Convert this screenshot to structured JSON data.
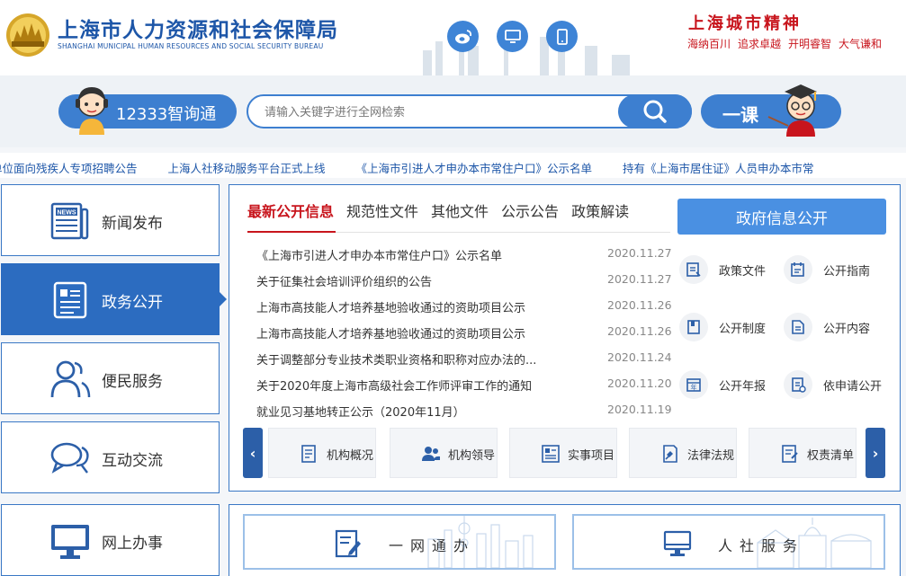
{
  "header": {
    "title_cn": "上海市人力资源和社会保障局",
    "title_en": "SHANGHAI MUNICIPAL HUMAN RESOURCES AND SOCIAL SECURITY BUREAU",
    "social_icons": [
      "weibo-icon",
      "desktop-icon",
      "mobile-icon"
    ],
    "spirit_title": "上海城市精神",
    "spirit_words": [
      "海纳百川",
      "追求卓越",
      "开明睿智",
      "大气谦和"
    ]
  },
  "search": {
    "hotline_label": "12333智询通",
    "placeholder": "请输入关键字进行全网检索",
    "course_label": "一课"
  },
  "ticker": {
    "items": [
      "单位面向残疾人专项招聘公告",
      "上海人社移动服务平台正式上线",
      "《上海市引进人才申办本市常住户口》公示名单",
      "持有《上海市居住证》人员申办本市常"
    ]
  },
  "nav": {
    "items": [
      {
        "label": "新闻发布",
        "icon": "newspaper-icon"
      },
      {
        "label": "政务公开",
        "icon": "document-icon",
        "active": true
      },
      {
        "label": "便民服务",
        "icon": "people-icon"
      },
      {
        "label": "互动交流",
        "icon": "chat-icon"
      },
      {
        "label": "网上办事",
        "icon": "monitor-icon"
      }
    ]
  },
  "main": {
    "tabs": [
      "最新公开信息",
      "规范性文件",
      "其他文件",
      "公示公告",
      "政策解读"
    ],
    "news": [
      {
        "title": "《上海市引进人才申办本市常住户口》公示名单",
        "date": "2020.11.27"
      },
      {
        "title": "关于征集社会培训评价组织的公告",
        "date": "2020.11.27"
      },
      {
        "title": "上海市高技能人才培养基地验收通过的资助项目公示",
        "date": "2020.11.26"
      },
      {
        "title": "上海市高技能人才培养基地验收通过的资助项目公示",
        "date": "2020.11.26"
      },
      {
        "title": "关于调整部分专业技术类职业资格和职称对应办法的...",
        "date": "2020.11.24"
      },
      {
        "title": "关于2020年度上海市高级社会工作师评审工作的通知",
        "date": "2020.11.20"
      },
      {
        "title": "就业见习基地转正公示（2020年11月）",
        "date": "2020.11.19"
      }
    ],
    "gov_open_label": "政府信息公开",
    "gov_items": [
      "政策文件",
      "公开指南",
      "公开制度",
      "公开内容",
      "公开年报",
      "依申请公开"
    ],
    "carousel": [
      "机构概况",
      "机构领导",
      "实事项目",
      "法律法规",
      "权责清单"
    ]
  },
  "bottom": {
    "cards": [
      "一网通办",
      "人社服务"
    ]
  },
  "colors": {
    "brand_blue": "#2c6cc0",
    "accent_red": "#c8151d"
  }
}
